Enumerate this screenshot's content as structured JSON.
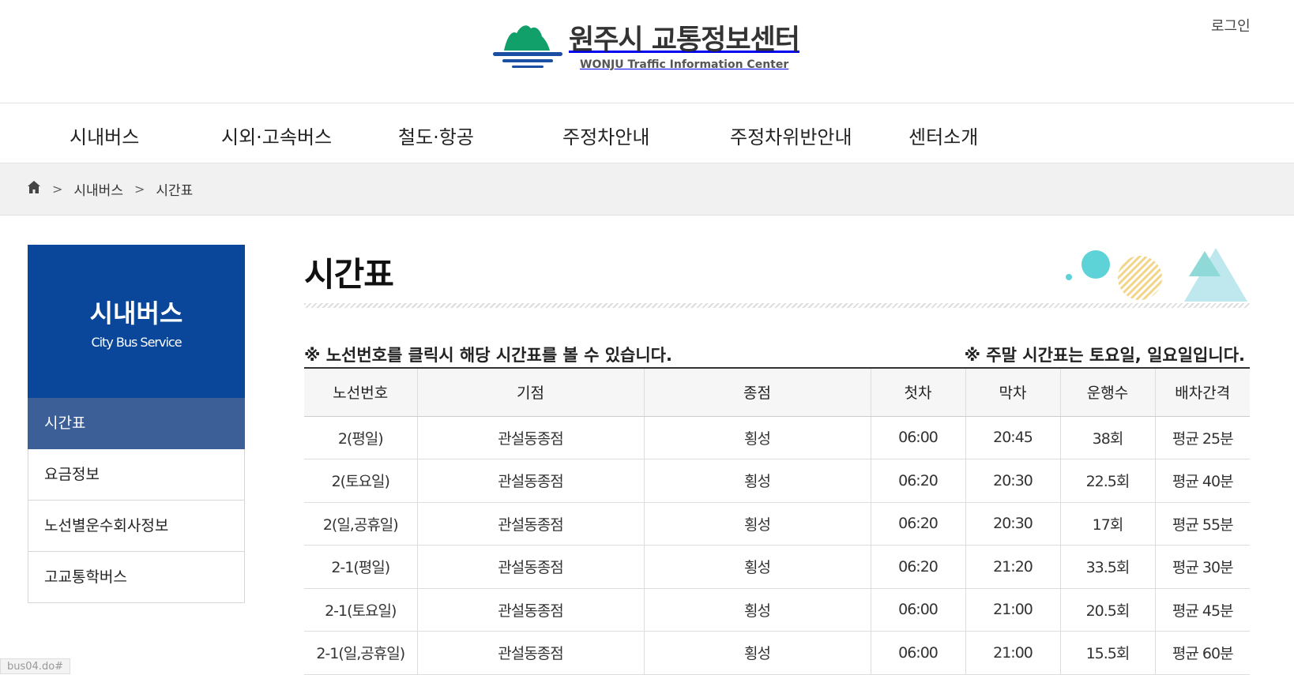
{
  "header": {
    "logo_title": "원주시 교통정보센터",
    "logo_sub": "WONJU Traffic Information Center",
    "login": "로그인"
  },
  "nav": [
    "시내버스",
    "시외·고속버스",
    "철도·항공",
    "주정차안내",
    "주정차위반안내",
    "센터소개"
  ],
  "breadcrumb": {
    "level1": "시내버스",
    "level2": "시간표"
  },
  "sidebar": {
    "title": "시내버스",
    "subtitle": "City Bus Service",
    "items": [
      "시간표",
      "요금정보",
      "노선별운수회사정보",
      "고교통학버스"
    ]
  },
  "main": {
    "title": "시간표",
    "note_left": "※ 노선번호를 클릭시 해당 시간표를 볼 수 있습니다.",
    "note_right": "※ 주말 시간표는 토요일, 일요일입니다."
  },
  "table": {
    "headers": [
      "노선번호",
      "기점",
      "종점",
      "첫차",
      "막차",
      "운행수",
      "배차간격"
    ],
    "rows": [
      [
        "2(평일)",
        "관설동종점",
        "횡성",
        "06:00",
        "20:45",
        "38회",
        "평균 25분"
      ],
      [
        "2(토요일)",
        "관설동종점",
        "횡성",
        "06:20",
        "20:30",
        "22.5회",
        "평균 40분"
      ],
      [
        "2(일,공휴일)",
        "관설동종점",
        "횡성",
        "06:20",
        "20:30",
        "17회",
        "평균 55분"
      ],
      [
        "2-1(평일)",
        "관설동종점",
        "횡성",
        "06:20",
        "21:20",
        "33.5회",
        "평균 30분"
      ],
      [
        "2-1(토요일)",
        "관설동종점",
        "횡성",
        "06:00",
        "21:00",
        "20.5회",
        "평균 45분"
      ],
      [
        "2-1(일,공휴일)",
        "관설동종점",
        "횡성",
        "06:00",
        "21:00",
        "15.5회",
        "평균 60분"
      ]
    ]
  },
  "statusbar": "bus04.do#",
  "colors": {
    "brand_blue": "#0a479a",
    "active_item": "#3d5f98",
    "deco_teal": "#5dd3d8",
    "deco_yellow": "#f3d58a"
  }
}
